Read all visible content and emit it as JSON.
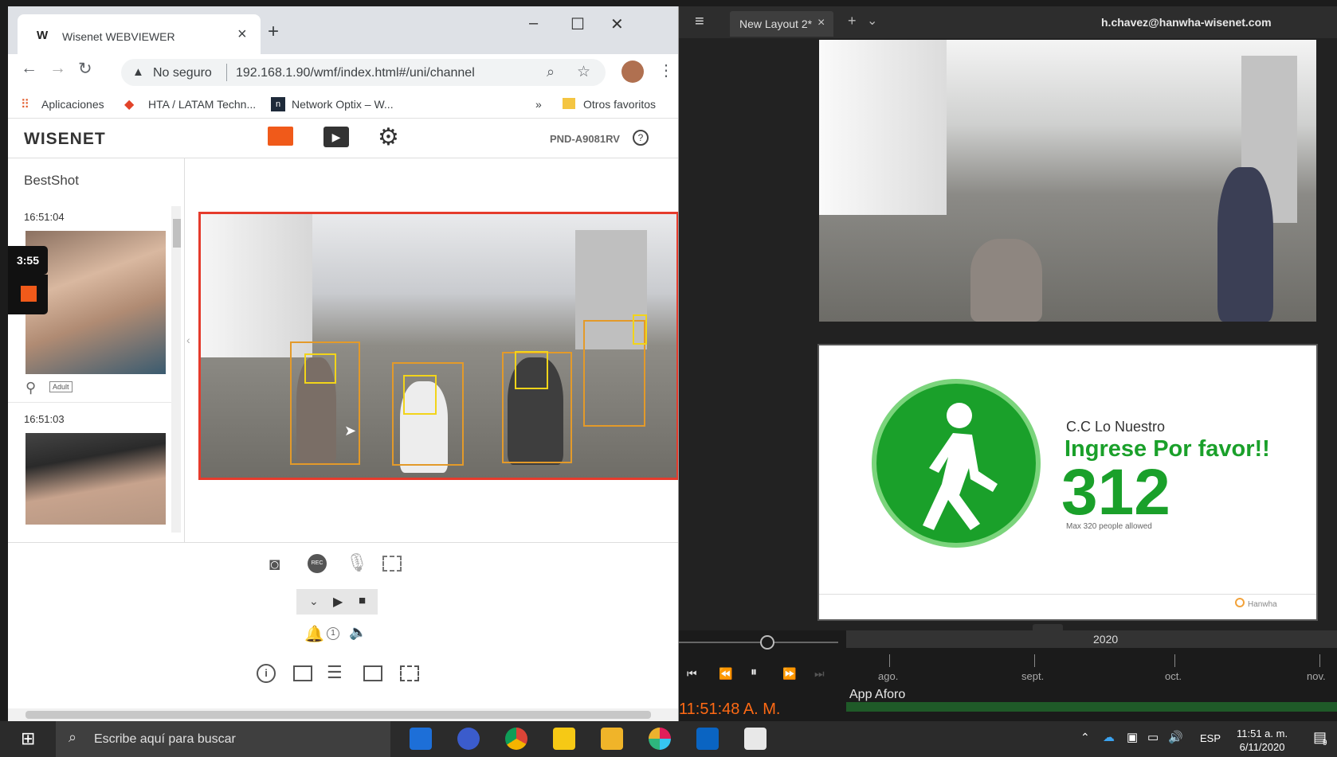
{
  "chrome": {
    "tab_title": "Wisenet WEBVIEWER",
    "tab_favicon": "W",
    "new_tab": "+",
    "security_label": "No seguro",
    "url": "192.168.1.90/wmf/index.html#/uni/channel",
    "bookmarks": [
      {
        "label": "Aplicaciones",
        "icon": "apps-grid-icon"
      },
      {
        "label": "HTA / LATAM Techn...",
        "icon": "gitlab-fox-icon"
      },
      {
        "label": "Network Optix – W...",
        "icon": "network-optix-icon"
      }
    ],
    "bookmarks_overflow": "»",
    "other_bookmarks": "Otros favoritos"
  },
  "wisenet": {
    "logo": "WISENET",
    "model": "PND-A9081RV",
    "sidebar_title": "BestShot",
    "bestshots": [
      {
        "time": "16:51:04",
        "tag": "Adult"
      },
      {
        "time": "16:51:03"
      }
    ],
    "overlay_timer": "3:55",
    "alarm_count": "1"
  },
  "nx": {
    "tab_title": "New Layout 2*",
    "user": "h.chavez@hanwha-wisenet.com",
    "counter": {
      "place": "C.C Lo Nuestro",
      "message": "Ingrese Por favor!!",
      "count": "312",
      "max_line": "Max 320 people allowed",
      "brand": "Hanwha"
    },
    "timeline": {
      "year": "2020",
      "months": [
        "ago.",
        "sept.",
        "oct.",
        "nov."
      ],
      "layer_label": "App Aforo",
      "clock": "11:51:48 A. M."
    }
  },
  "taskbar": {
    "search_placeholder": "Escribe aquí para buscar",
    "lang": "ESP",
    "time": "11:51 a. m.",
    "date": "6/11/2020",
    "notification_count": "9"
  },
  "colors": {
    "accent_orange": "#f05a1a",
    "nx_green": "#1aa02a",
    "video_border": "#e53b2c"
  }
}
